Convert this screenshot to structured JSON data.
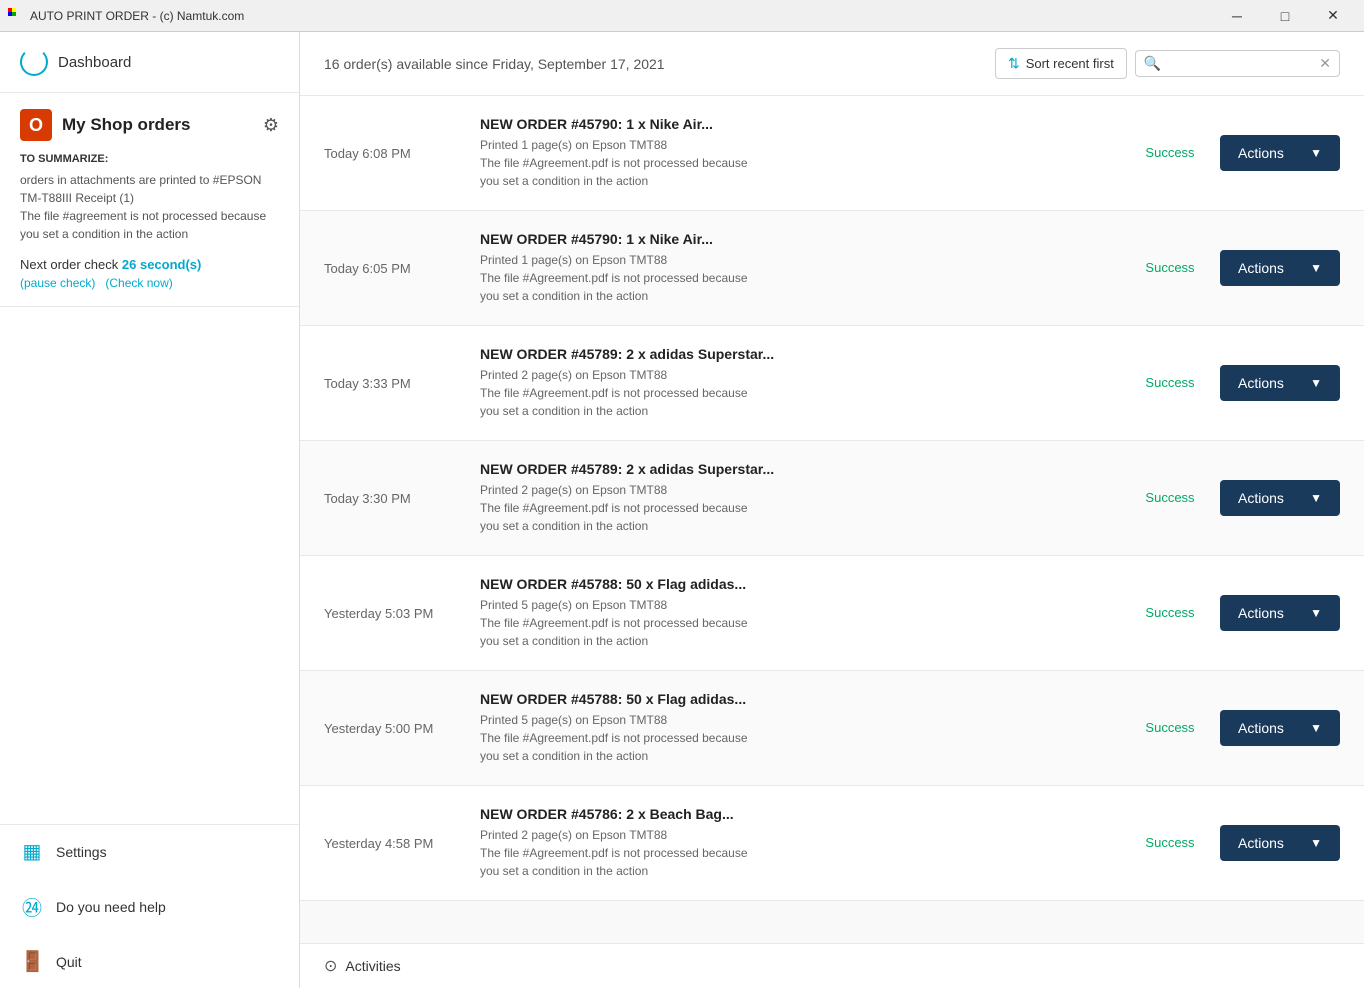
{
  "titleBar": {
    "title": "AUTO PRINT ORDER - (c) Namtuk.com",
    "controls": {
      "minimize": "─",
      "maximize": "□",
      "close": "✕"
    }
  },
  "sidebar": {
    "dashboard": {
      "label": "Dashboard"
    },
    "shop": {
      "title": "My Shop orders",
      "icon_letter": "O"
    },
    "summary": {
      "label": "TO SUMMARIZE:",
      "lines": [
        "orders in attachments are printed to #EPSON",
        "TM-T88III Receipt (1)",
        "The file #agreement is not processed because",
        "you set a condition in the action"
      ]
    },
    "nextCheck": {
      "label": "Next order check",
      "seconds": "26 second(s)",
      "pauseLabel": "(pause check)",
      "checkNowLabel": "(Check now)"
    },
    "nav": {
      "settings": "Settings",
      "help": "Do you need help",
      "quit": "Quit"
    }
  },
  "header": {
    "ordersCount": "16 order(s) available since Friday, September 17, 2021",
    "sortLabel": "Sort recent first",
    "searchPlaceholder": ""
  },
  "orders": [
    {
      "time": "Today 6:08 PM",
      "title": "NEW ORDER #45790: 1 x Nike Air...",
      "detail1": "Printed 1 page(s) on Epson TMT88",
      "detail2": "The file #Agreement.pdf is not processed because",
      "detail3": "you set a condition in the action",
      "status": "Success",
      "actionLabel": "Actions"
    },
    {
      "time": "Today 6:05 PM",
      "title": "NEW ORDER #45790: 1 x Nike Air...",
      "detail1": "Printed 1 page(s) on Epson TMT88",
      "detail2": "The file #Agreement.pdf is not processed because",
      "detail3": "you set a condition in the action",
      "status": "Success",
      "actionLabel": "Actions"
    },
    {
      "time": "Today 3:33 PM",
      "title": "NEW ORDER #45789: 2 x adidas Superstar...",
      "detail1": "Printed 2 page(s) on Epson TMT88",
      "detail2": "The file #Agreement.pdf is not processed because",
      "detail3": "you set a condition in the action",
      "status": "Success",
      "actionLabel": "Actions"
    },
    {
      "time": "Today 3:30 PM",
      "title": "NEW ORDER #45789: 2 x adidas Superstar...",
      "detail1": "Printed 2 page(s) on Epson TMT88",
      "detail2": "The file #Agreement.pdf is not processed because",
      "detail3": "you set a condition in the action",
      "status": "Success",
      "actionLabel": "Actions"
    },
    {
      "time": "Yesterday 5:03 PM",
      "title": "NEW ORDER #45788: 50 x Flag adidas...",
      "detail1": "Printed 5 page(s) on Epson TMT88",
      "detail2": "The file #Agreement.pdf is not processed because",
      "detail3": "you set a condition in the action",
      "status": "Success",
      "actionLabel": "Actions"
    },
    {
      "time": "Yesterday 5:00 PM",
      "title": "NEW ORDER #45788: 50 x Flag adidas...",
      "detail1": "Printed 5 page(s) on Epson TMT88",
      "detail2": "The file #Agreement.pdf is not processed because",
      "detail3": "you set a condition in the action",
      "status": "Success",
      "actionLabel": "Actions"
    },
    {
      "time": "Yesterday 4:58 PM",
      "title": "NEW ORDER #45786: 2 x Beach Bag...",
      "detail1": "Printed 2 page(s) on Epson TMT88",
      "detail2": "The file #Agreement.pdf is not processed because",
      "detail3": "you set a condition in the action",
      "status": "Success",
      "actionLabel": "Actions"
    }
  ],
  "activities": {
    "label": "Activities"
  }
}
